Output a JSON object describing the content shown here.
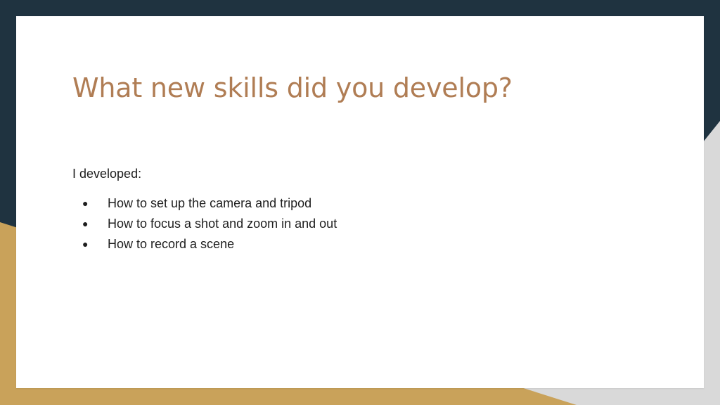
{
  "slide": {
    "title": "What new skills did you develop?",
    "intro": "I developed:",
    "bullets": [
      "How to set up the camera and tripod",
      "How to focus a shot and zoom in and out",
      "How to record a scene"
    ],
    "bullet_glyph": "●"
  },
  "theme": {
    "background_dark": "#1f3340",
    "accent_gold": "#c9a25a",
    "accent_grey": "#d9d9d9",
    "title_color": "#b07d54",
    "text_color": "#1e1e1e",
    "card_color": "#ffffff"
  }
}
